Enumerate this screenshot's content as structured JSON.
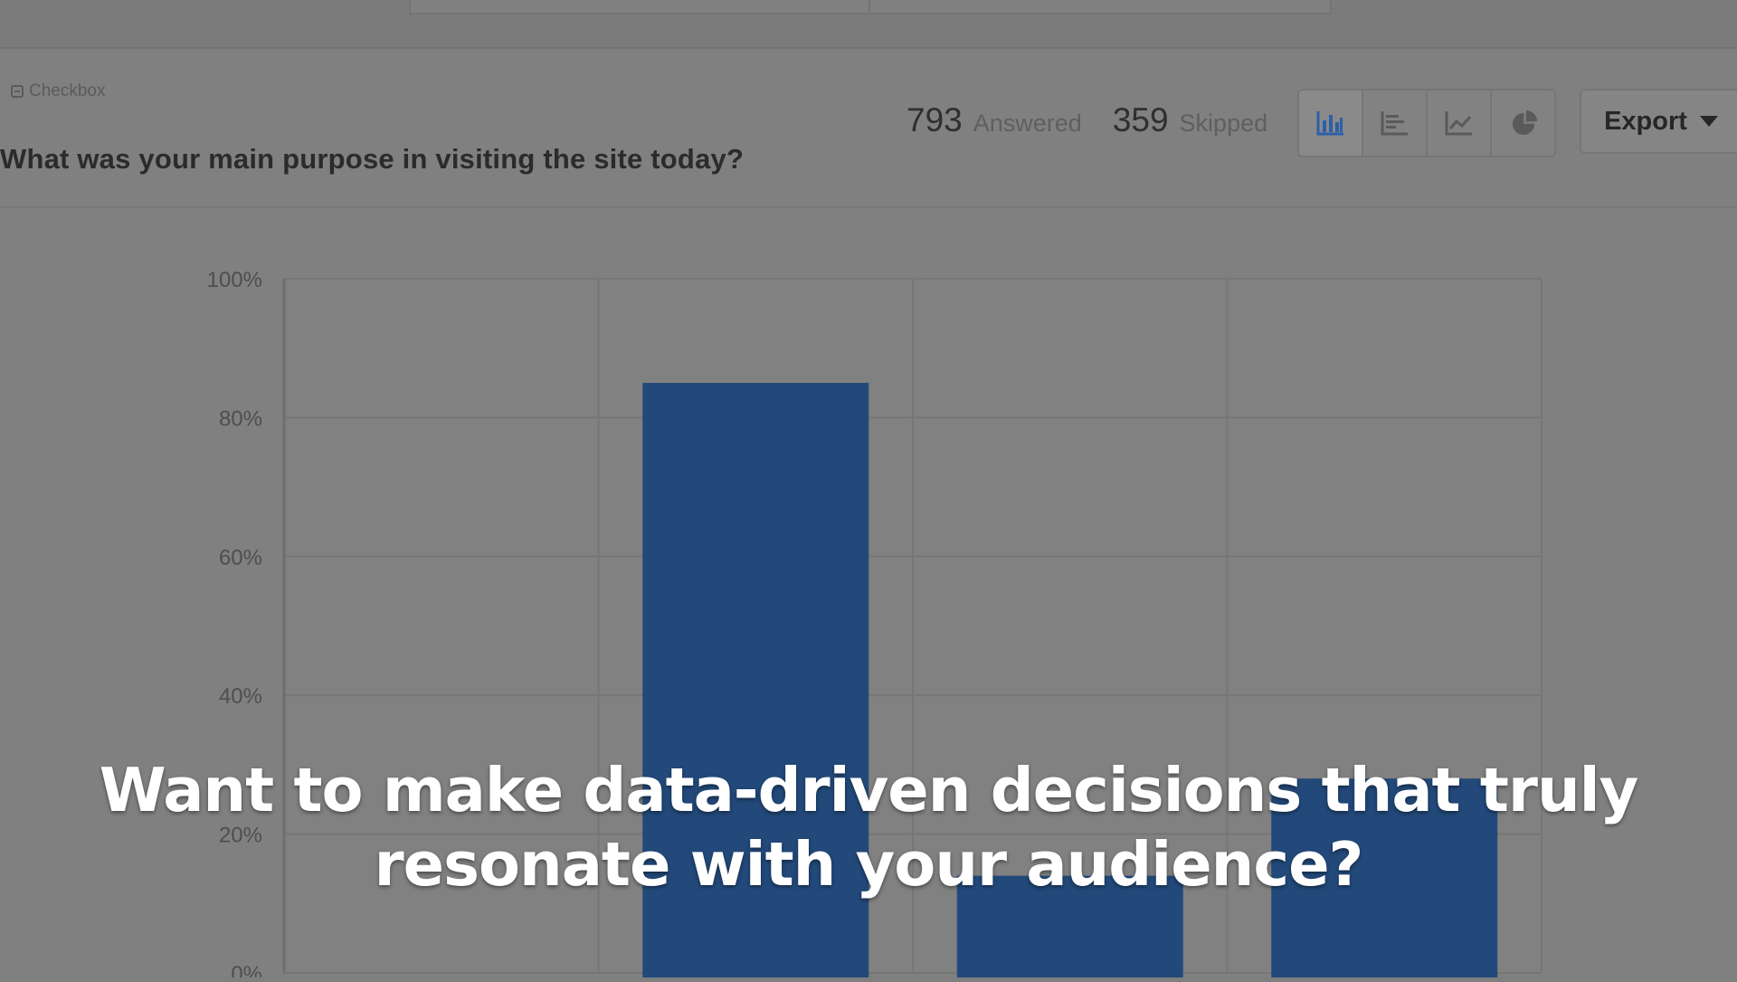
{
  "question": {
    "type_label": "Checkbox",
    "title": "What was your main purpose in visiting the site today?"
  },
  "stats": {
    "answered_count": "793",
    "answered_label": "Answered",
    "skipped_count": "359",
    "skipped_label": "Skipped"
  },
  "view_toggle": {
    "items": [
      {
        "icon": "vertical-bar-chart-icon",
        "active": true
      },
      {
        "icon": "horizontal-bar-chart-icon",
        "active": false
      },
      {
        "icon": "line-chart-icon",
        "active": false
      },
      {
        "icon": "pie-chart-icon",
        "active": false
      }
    ]
  },
  "export": {
    "label": "Export"
  },
  "caption": {
    "line1": "Want to make data-driven decisions that truly",
    "line2": "resonate with your audience?"
  },
  "colors": {
    "bar": "#22497a",
    "active_icon": "#2d5fa8"
  },
  "chart_data": {
    "type": "bar",
    "categories": [
      "",
      "",
      "",
      ""
    ],
    "values": [
      0,
      85,
      14,
      28
    ],
    "y_ticks": [
      "100%",
      "80%",
      "60%",
      "40%",
      "20%",
      "0%"
    ],
    "ylim": [
      0,
      100
    ],
    "grid": true
  }
}
